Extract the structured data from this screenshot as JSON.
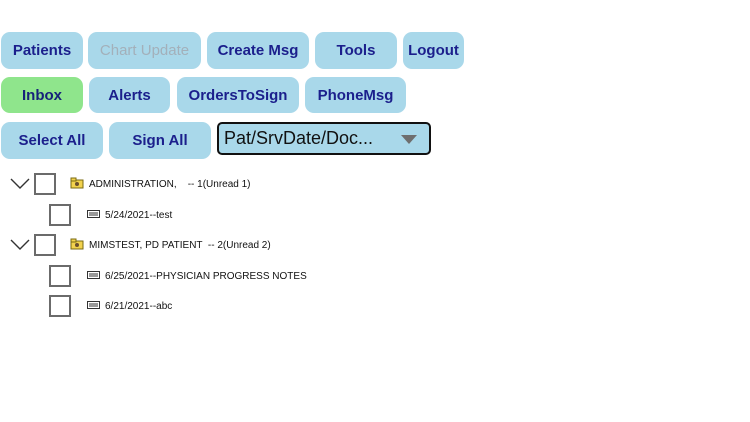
{
  "toolbar_row1": [
    {
      "label": "Patients"
    },
    {
      "label": "Chart Update"
    },
    {
      "label": "Create Msg"
    },
    {
      "label": "Tools"
    },
    {
      "label": "Logout"
    }
  ],
  "toolbar_row2": [
    {
      "label": "Inbox"
    },
    {
      "label": "Alerts"
    },
    {
      "label": "OrdersToSign"
    },
    {
      "label": "PhoneMsg"
    }
  ],
  "actions": {
    "select_all": "Select All",
    "sign_all": "Sign All"
  },
  "sort_dropdown": {
    "selected": "Pat/SrvDate/Doc..."
  },
  "groups": [
    {
      "patient": "ADMINISTRATION,    -- 1(Unread 1)",
      "items": [
        "5/24/2021--test"
      ]
    },
    {
      "patient": "MIMSTEST, PD PATIENT  -- 2(Unread 2)",
      "items": [
        "6/25/2021--PHYSICIAN PROGRESS NOTES",
        "6/21/2021--abc"
      ]
    }
  ],
  "colors": {
    "button_bg": "#a9d8ea",
    "active_tab_bg": "#8fe58c",
    "button_text": "#1b1f8c",
    "disabled_text": "#a3b0ba"
  }
}
